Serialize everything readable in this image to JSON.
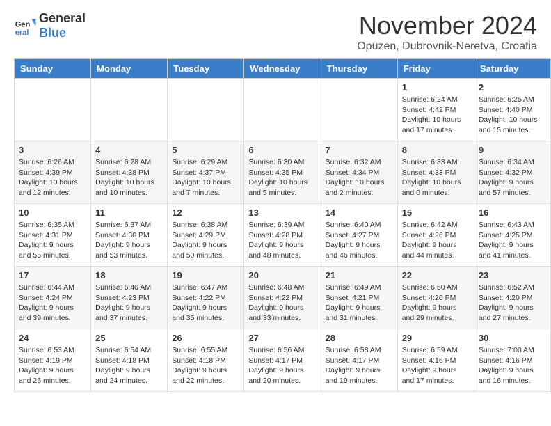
{
  "header": {
    "logo_general": "General",
    "logo_blue": "Blue",
    "month_title": "November 2024",
    "location": "Opuzen, Dubrovnik-Neretva, Croatia"
  },
  "weekdays": [
    "Sunday",
    "Monday",
    "Tuesday",
    "Wednesday",
    "Thursday",
    "Friday",
    "Saturday"
  ],
  "weeks": [
    [
      {
        "day": "",
        "info": ""
      },
      {
        "day": "",
        "info": ""
      },
      {
        "day": "",
        "info": ""
      },
      {
        "day": "",
        "info": ""
      },
      {
        "day": "",
        "info": ""
      },
      {
        "day": "1",
        "info": "Sunrise: 6:24 AM\nSunset: 4:42 PM\nDaylight: 10 hours and 17 minutes."
      },
      {
        "day": "2",
        "info": "Sunrise: 6:25 AM\nSunset: 4:40 PM\nDaylight: 10 hours and 15 minutes."
      }
    ],
    [
      {
        "day": "3",
        "info": "Sunrise: 6:26 AM\nSunset: 4:39 PM\nDaylight: 10 hours and 12 minutes."
      },
      {
        "day": "4",
        "info": "Sunrise: 6:28 AM\nSunset: 4:38 PM\nDaylight: 10 hours and 10 minutes."
      },
      {
        "day": "5",
        "info": "Sunrise: 6:29 AM\nSunset: 4:37 PM\nDaylight: 10 hours and 7 minutes."
      },
      {
        "day": "6",
        "info": "Sunrise: 6:30 AM\nSunset: 4:35 PM\nDaylight: 10 hours and 5 minutes."
      },
      {
        "day": "7",
        "info": "Sunrise: 6:32 AM\nSunset: 4:34 PM\nDaylight: 10 hours and 2 minutes."
      },
      {
        "day": "8",
        "info": "Sunrise: 6:33 AM\nSunset: 4:33 PM\nDaylight: 10 hours and 0 minutes."
      },
      {
        "day": "9",
        "info": "Sunrise: 6:34 AM\nSunset: 4:32 PM\nDaylight: 9 hours and 57 minutes."
      }
    ],
    [
      {
        "day": "10",
        "info": "Sunrise: 6:35 AM\nSunset: 4:31 PM\nDaylight: 9 hours and 55 minutes."
      },
      {
        "day": "11",
        "info": "Sunrise: 6:37 AM\nSunset: 4:30 PM\nDaylight: 9 hours and 53 minutes."
      },
      {
        "day": "12",
        "info": "Sunrise: 6:38 AM\nSunset: 4:29 PM\nDaylight: 9 hours and 50 minutes."
      },
      {
        "day": "13",
        "info": "Sunrise: 6:39 AM\nSunset: 4:28 PM\nDaylight: 9 hours and 48 minutes."
      },
      {
        "day": "14",
        "info": "Sunrise: 6:40 AM\nSunset: 4:27 PM\nDaylight: 9 hours and 46 minutes."
      },
      {
        "day": "15",
        "info": "Sunrise: 6:42 AM\nSunset: 4:26 PM\nDaylight: 9 hours and 44 minutes."
      },
      {
        "day": "16",
        "info": "Sunrise: 6:43 AM\nSunset: 4:25 PM\nDaylight: 9 hours and 41 minutes."
      }
    ],
    [
      {
        "day": "17",
        "info": "Sunrise: 6:44 AM\nSunset: 4:24 PM\nDaylight: 9 hours and 39 minutes."
      },
      {
        "day": "18",
        "info": "Sunrise: 6:46 AM\nSunset: 4:23 PM\nDaylight: 9 hours and 37 minutes."
      },
      {
        "day": "19",
        "info": "Sunrise: 6:47 AM\nSunset: 4:22 PM\nDaylight: 9 hours and 35 minutes."
      },
      {
        "day": "20",
        "info": "Sunrise: 6:48 AM\nSunset: 4:22 PM\nDaylight: 9 hours and 33 minutes."
      },
      {
        "day": "21",
        "info": "Sunrise: 6:49 AM\nSunset: 4:21 PM\nDaylight: 9 hours and 31 minutes."
      },
      {
        "day": "22",
        "info": "Sunrise: 6:50 AM\nSunset: 4:20 PM\nDaylight: 9 hours and 29 minutes."
      },
      {
        "day": "23",
        "info": "Sunrise: 6:52 AM\nSunset: 4:20 PM\nDaylight: 9 hours and 27 minutes."
      }
    ],
    [
      {
        "day": "24",
        "info": "Sunrise: 6:53 AM\nSunset: 4:19 PM\nDaylight: 9 hours and 26 minutes."
      },
      {
        "day": "25",
        "info": "Sunrise: 6:54 AM\nSunset: 4:18 PM\nDaylight: 9 hours and 24 minutes."
      },
      {
        "day": "26",
        "info": "Sunrise: 6:55 AM\nSunset: 4:18 PM\nDaylight: 9 hours and 22 minutes."
      },
      {
        "day": "27",
        "info": "Sunrise: 6:56 AM\nSunset: 4:17 PM\nDaylight: 9 hours and 20 minutes."
      },
      {
        "day": "28",
        "info": "Sunrise: 6:58 AM\nSunset: 4:17 PM\nDaylight: 9 hours and 19 minutes."
      },
      {
        "day": "29",
        "info": "Sunrise: 6:59 AM\nSunset: 4:16 PM\nDaylight: 9 hours and 17 minutes."
      },
      {
        "day": "30",
        "info": "Sunrise: 7:00 AM\nSunset: 4:16 PM\nDaylight: 9 hours and 16 minutes."
      }
    ]
  ]
}
